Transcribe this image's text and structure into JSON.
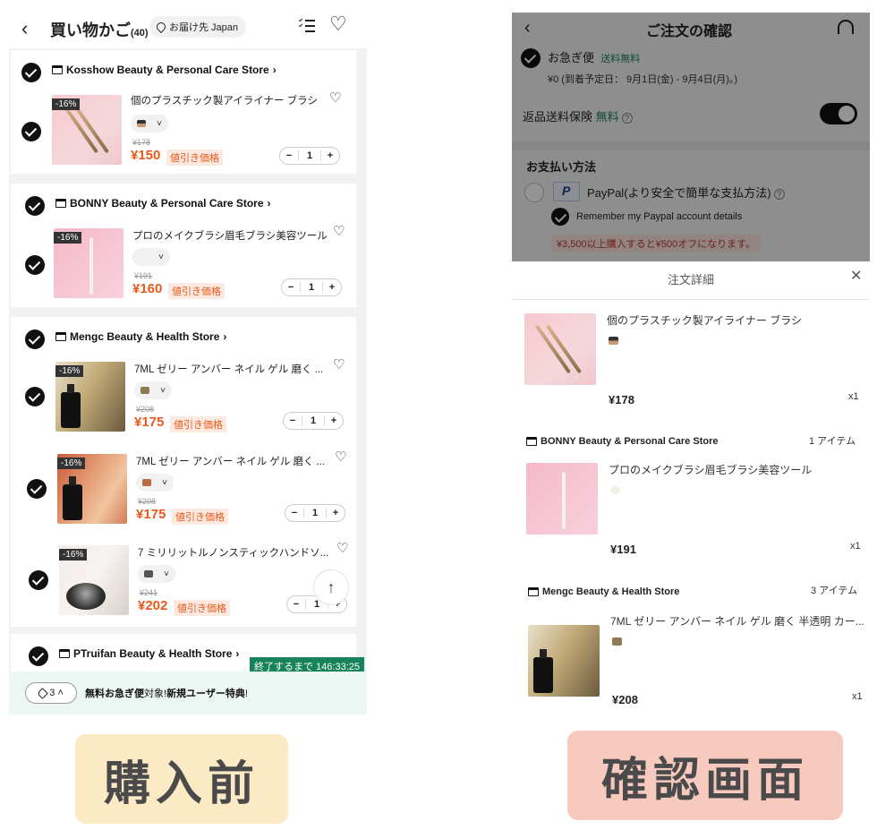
{
  "cart": {
    "title": "買い物かご",
    "count": "(40)",
    "ship_to": "お届け先 Japan",
    "stores": [
      {
        "name": "Kosshow Beauty & Personal Care Store",
        "items": [
          {
            "discount": "-16%",
            "title": "個のプラスチック製アイライナー ブラシ",
            "old_price": "¥178",
            "price": "¥150",
            "price_tag": "値引き価格",
            "qty": "1"
          }
        ]
      },
      {
        "name": "BONNY Beauty & Personal Care Store",
        "items": [
          {
            "discount": "-16%",
            "title": "プロのメイクブラシ眉毛ブラシ美容ツール",
            "old_price": "¥191",
            "price": "¥160",
            "price_tag": "値引き価格",
            "qty": "1"
          }
        ]
      },
      {
        "name": "Mengc Beauty & Health Store",
        "items": [
          {
            "discount": "-16%",
            "title": "7ML ゼリー アンバー ネイル ゲル 磨く ...",
            "old_price": "¥208",
            "price": "¥175",
            "price_tag": "値引き価格",
            "qty": "1"
          },
          {
            "discount": "-16%",
            "title": "7ML ゼリー アンバー ネイル ゲル 磨く ...",
            "old_price": "¥208",
            "price": "¥175",
            "price_tag": "値引き価格",
            "qty": "1"
          },
          {
            "discount": "-16%",
            "title": "7 ミリリットルノンスティックハンドソ...",
            "old_price": "¥241",
            "price": "¥202",
            "price_tag": "値引き価格",
            "qty": "1"
          }
        ]
      },
      {
        "name": "PTruifan Beauty & Health Store",
        "items": []
      }
    ],
    "timer": "終了するまで 146:33:25",
    "coupon_count": "3",
    "promo": {
      "bold1": "無料お急ぎ便",
      "mid": "対象!",
      "bold2": "新規ユーザー特典",
      "end": "!"
    }
  },
  "confirm": {
    "title": "ご注文の確認",
    "shipping_name": "お急ぎ便",
    "shipping_free": "送料無料",
    "shipping_detail": "¥0 (到着予定日： 9月1日(金) - 9月4日(月)。)",
    "insurance_label": "返品送料保険",
    "insurance_free": "無料",
    "payment_heading": "お支払い方法",
    "paypal_option": "PayPal(より安全で簡単な支払方法)",
    "remember_label": "Remember my Paypal account details",
    "pay_promo": "¥3,500以上購入すると¥500オフになります。",
    "detail_heading": "注文詳細",
    "groups": [
      {
        "store": "",
        "count": "",
        "items": [
          {
            "title": "個のプラスチック製アイライナー ブラシ",
            "price": "¥178",
            "qty": "x1"
          }
        ]
      },
      {
        "store": "BONNY Beauty & Personal Care Store",
        "count": "1 アイテム",
        "items": [
          {
            "title": "プロのメイクブラシ眉毛ブラシ美容ツール",
            "price": "¥191",
            "qty": "x1"
          }
        ]
      },
      {
        "store": "Mengc Beauty & Health Store",
        "count": "3 アイテム",
        "items": [
          {
            "title": "7ML ゼリー アンバー ネイル ゲル 磨く 半透明 カー...",
            "price": "¥208",
            "qty": "x1"
          }
        ]
      }
    ]
  },
  "captions": {
    "left": "購入前",
    "right": "確認画面"
  },
  "colors": {
    "price": "#e85a1c",
    "green": "#17835a",
    "caption_left_bg": "#fbeac4",
    "caption_right_bg": "#f8c9bf"
  }
}
